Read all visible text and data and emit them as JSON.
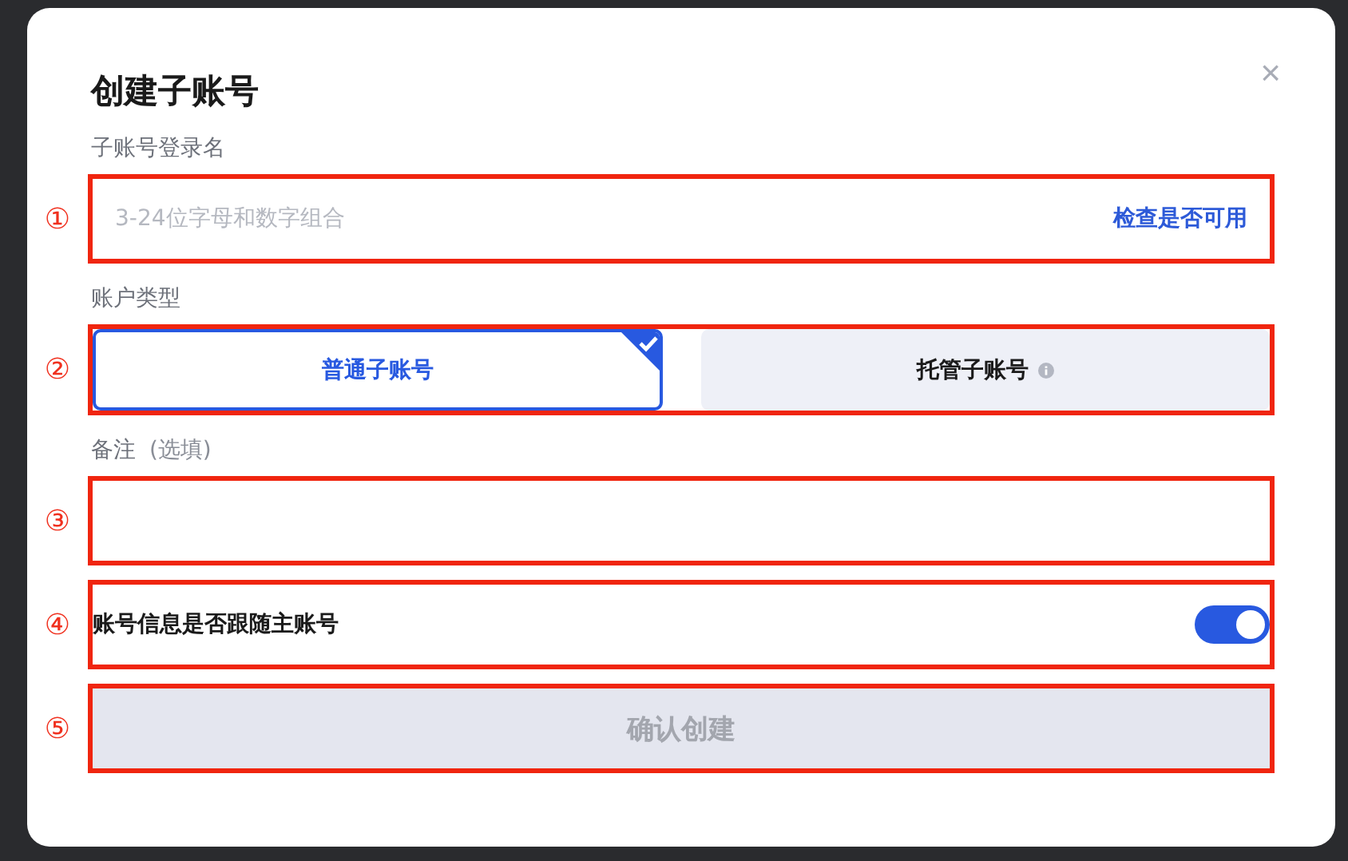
{
  "dialog": {
    "title": "创建子账号",
    "close": "×"
  },
  "sections": [
    {
      "kind": "input",
      "label": "子账号登录名",
      "marker": "①",
      "placeholder": "3-24位字母和数字组合",
      "action": "检查是否可用"
    },
    {
      "kind": "choice",
      "label": "账户类型",
      "marker": "②",
      "options": [
        {
          "label": "普通子账号",
          "selected": true,
          "info": false
        },
        {
          "label": "托管子账号",
          "selected": false,
          "info": true
        }
      ]
    },
    {
      "kind": "textarea",
      "label": "备注",
      "hint": "(选填)",
      "marker": "③"
    },
    {
      "kind": "toggle",
      "marker": "④",
      "text": "账号信息是否跟随主账号",
      "on": true
    },
    {
      "kind": "button",
      "marker": "⑤",
      "text": "确认创建",
      "disabled": true
    }
  ]
}
